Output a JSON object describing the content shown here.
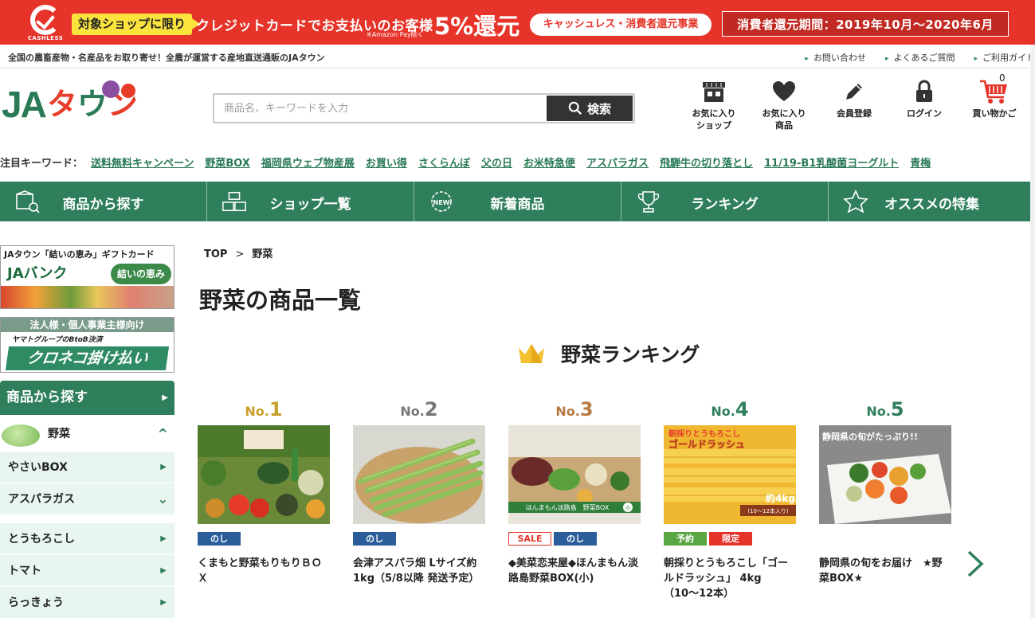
{
  "banner": {
    "logo_text": "CASHLESS",
    "target": "対象ショップに限り",
    "message": "クレジットカードでお支払いのお客様",
    "note": "※Amazon Pay除く",
    "percent": "5%還元",
    "pill": "キャッシュレス・消費者還元事業",
    "period": "消費者還元期間：2019年10月〜2020年6月",
    "color": "#e6342a"
  },
  "util": {
    "tagline": "全国の農畜産物・名産品をお取り寄せ！全農が運営する産地直送通販のJAタウン",
    "links": [
      "お問い合わせ",
      "よくあるご質問",
      "ご利用ガイド"
    ]
  },
  "header": {
    "logo_ja": "JA",
    "logo_town": [
      "タ",
      "ウ",
      "ン"
    ],
    "search_placeholder": "商品名、キーワードを入力",
    "search_button": "検索",
    "icons": [
      {
        "icon": "shop-icon",
        "label": "お気に入り\nショップ"
      },
      {
        "icon": "heart-icon",
        "label": "お気に入り\n商品"
      },
      {
        "icon": "pencil-icon",
        "label": "会員登録"
      },
      {
        "icon": "lock-icon",
        "label": "ログイン"
      },
      {
        "icon": "cart-icon",
        "label": "買い物かご",
        "count": "0"
      }
    ]
  },
  "keywords": {
    "title": "注目キーワード：",
    "items": [
      "送料無料キャンペーン",
      "野菜BOX",
      "福岡県ウェブ物産展",
      "お買い得",
      "さくらんぼ",
      "父の日",
      "お米特急便",
      "アスパラガス",
      "飛騨牛の切り落とし",
      "11/19-B1乳酸菌ヨーグルト",
      "青梅"
    ]
  },
  "nav": [
    {
      "icon": "box-search-icon",
      "label": "商品から探す"
    },
    {
      "icon": "shops-icon",
      "label": "ショップ一覧"
    },
    {
      "icon": "new-badge-icon",
      "label": "新着商品"
    },
    {
      "icon": "trophy-icon",
      "label": "ランキング"
    },
    {
      "icon": "star-icon",
      "label": "オススメの特集"
    }
  ],
  "sidebar": {
    "banner1": {
      "title": "JAタウン「結いの恵み」ギフトカード",
      "bank": "JAバンク",
      "badge": "結いの恵み"
    },
    "banner2": {
      "head": "法人様・個人事業主様向け",
      "sub": "ヤマトグループのBtoB決済",
      "big": "クロネコ掛け払い"
    },
    "head": "商品から探す",
    "items": [
      {
        "label": "野菜",
        "current": true
      },
      {
        "label": "やさいBOX"
      },
      {
        "label": "アスパラガス",
        "expanded": true
      },
      {
        "label": "とうもろこし"
      },
      {
        "label": "トマト"
      },
      {
        "label": "らっきょう"
      }
    ]
  },
  "breadcrumb": {
    "top": "TOP",
    "sep": ">",
    "current": "野菜"
  },
  "page_title": "野菜の商品一覧",
  "ranking": {
    "title": "野菜ランキング",
    "items": [
      {
        "no_prefix": "No.",
        "no": "1",
        "color": "#c9a02a",
        "tags": [
          "のし"
        ],
        "name": "くまもと野菜もりもりＢＯＸ"
      },
      {
        "no_prefix": "No.",
        "no": "2",
        "color": "#777777",
        "tags": [
          "のし"
        ],
        "name": "会津アスパラ畑 Lサイズ約1kg（5/8以降 発送予定）"
      },
      {
        "no_prefix": "No.",
        "no": "3",
        "color": "#b77a45",
        "tags": [
          "SALE",
          "のし"
        ],
        "name": "◆美菜恋来屋◆ほんまもん淡路島野菜BOX(小)"
      },
      {
        "no_prefix": "No.",
        "no": "4",
        "color": "#2f7f5d",
        "tags": [
          "予約",
          "限定"
        ],
        "name": "朝採りとうもろこし「ゴールドラッシュ」 4kg（10〜12本）",
        "img_text": [
          "朝採りとうもろこし",
          "ゴールドラッシュ",
          "約4kg",
          "(10〜12本入り)"
        ]
      },
      {
        "no_prefix": "No.",
        "no": "5",
        "color": "#2f7f5d",
        "tags": [],
        "name": "静岡県の旬をお届け　★野菜BOX★",
        "img_text": [
          "静岡県の旬がたっぷり!!"
        ]
      }
    ],
    "img3_text": "ほんまもん淡路島　野菜BOX",
    "img3_badge": "小"
  }
}
